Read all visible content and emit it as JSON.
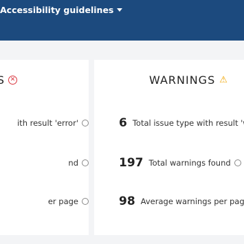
{
  "nav": {
    "menu_label": "Accessibility guidelines"
  },
  "errors_card": {
    "title": "S",
    "rows": [
      {
        "label": "ith result 'error'"
      },
      {
        "label": "nd"
      },
      {
        "label": "er page"
      }
    ]
  },
  "warnings_card": {
    "title": "WARNINGS",
    "rows": [
      {
        "value": "6",
        "label": "Total issue type with result 'w"
      },
      {
        "value": "197",
        "label": "Total warnings found"
      },
      {
        "value": "98",
        "label": "Average warnings per page"
      }
    ]
  },
  "colors": {
    "navbar": "#1c4a7e",
    "error": "#d9363e",
    "warning": "#f0a500"
  },
  "icons": {
    "error": "x-circle-icon",
    "warning": "warning-triangle-icon",
    "info": "info-circle-icon"
  }
}
